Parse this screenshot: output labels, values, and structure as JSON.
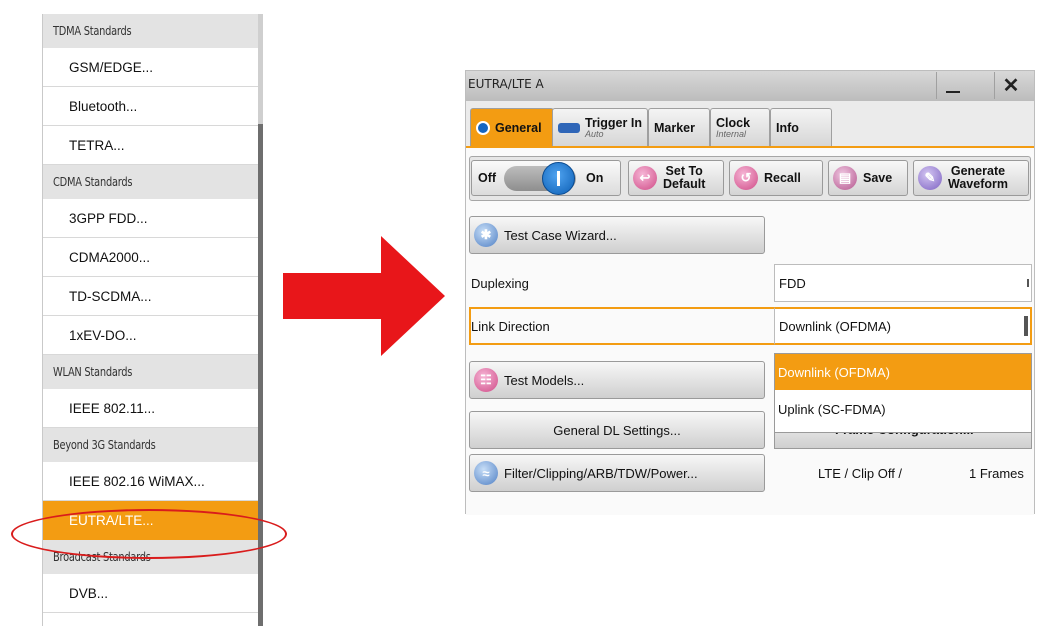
{
  "menu": {
    "entries": [
      {
        "kind": "category",
        "label": "TDMA Standards"
      },
      {
        "kind": "item",
        "label": "GSM/EDGE..."
      },
      {
        "kind": "item",
        "label": "Bluetooth..."
      },
      {
        "kind": "item",
        "label": "TETRA..."
      },
      {
        "kind": "category",
        "label": "CDMA Standards"
      },
      {
        "kind": "item",
        "label": "3GPP FDD..."
      },
      {
        "kind": "item",
        "label": "CDMA2000..."
      },
      {
        "kind": "item",
        "label": "TD-SCDMA..."
      },
      {
        "kind": "item",
        "label": "1xEV-DO..."
      },
      {
        "kind": "category",
        "label": "WLAN Standards"
      },
      {
        "kind": "item",
        "label": "IEEE 802.11..."
      },
      {
        "kind": "category",
        "label": "Beyond 3G Standards"
      },
      {
        "kind": "item",
        "label": "IEEE 802.16 WiMAX..."
      },
      {
        "kind": "item",
        "label": "EUTRA/LTE...",
        "selected": true
      },
      {
        "kind": "category",
        "label": "Broadcast Standards"
      },
      {
        "kind": "item",
        "label": "DVB..."
      }
    ]
  },
  "dialog": {
    "title": "EUTRA/LTE A",
    "close_glyph": "✕",
    "tabs": [
      {
        "label": "General",
        "sub": "",
        "active": true
      },
      {
        "label": "Trigger In",
        "sub": "Auto"
      },
      {
        "label": "Marker",
        "sub": ""
      },
      {
        "label": "Clock",
        "sub": "Internal"
      },
      {
        "label": "Info",
        "sub": ""
      }
    ],
    "toolbar": {
      "off_label": "Off",
      "on_label": "On",
      "set_default_label": [
        "Set To",
        "Default"
      ],
      "recall_label": "Recall",
      "save_label": "Save",
      "generate_label": [
        "Generate",
        "Waveform"
      ]
    },
    "test_case_wizard_label": "Test Case Wizard...",
    "duplexing": {
      "label": "Duplexing",
      "value": "FDD"
    },
    "link_direction": {
      "label": "Link Direction",
      "value": "Downlink (OFDMA)"
    },
    "dropdown_options": [
      "Downlink (OFDMA)",
      "Uplink (SC-FDMA)"
    ],
    "test_models_label": "Test Models...",
    "general_dl_label": "General DL Settings...",
    "frame_config_label": "Frame Configuration...",
    "filter_label": "Filter/Clipping/ARB/TDW/Power...",
    "filter_status": "LTE / Clip Off /",
    "frames_status": "1 Frames"
  },
  "colors": {
    "accent": "#f39c12",
    "highlight_oval": "#d91c1c",
    "arrow": "#e8161a"
  }
}
